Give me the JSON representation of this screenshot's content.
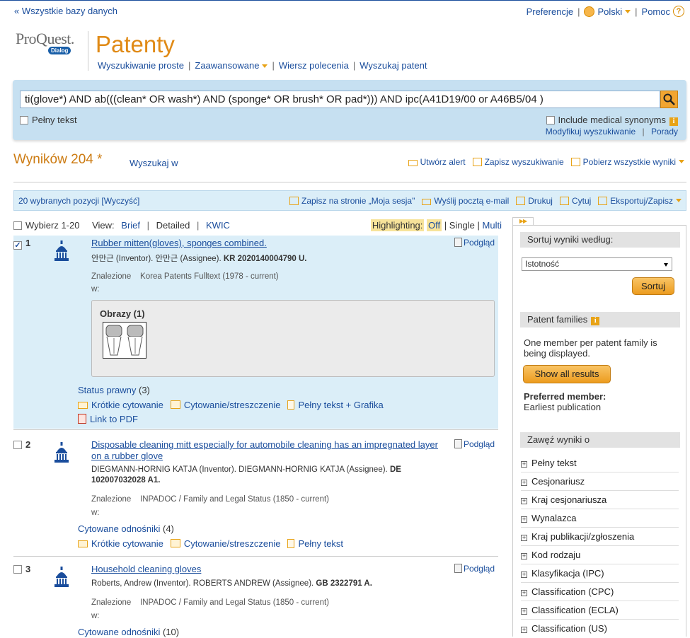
{
  "topbar": {
    "all_databases": "Wszystkie bazy danych",
    "preferences": "Preferencje",
    "language": "Polski",
    "help": "Pomoc"
  },
  "logo": {
    "brand": "ProQuest.",
    "sub": "Dialog"
  },
  "product_title": "Patenty",
  "search_nav": [
    "Wyszukiwanie proste",
    "Zaawansowane",
    "Wiersz polecenia",
    "Wyszukaj patent"
  ],
  "search": {
    "query": "ti(glove*) AND ab(((clean* OR wash*) AND (sponge* OR brush* OR pad*))) AND ipc(A41D19/00  or A46B5/04 )",
    "fulltext_label": "Pełny tekst",
    "medical_synonyms": "Include medical synonyms",
    "modify": "Modyfikuj wyszukiwanie",
    "tips": "Porady"
  },
  "results_header": {
    "count": "Wyników 204 *",
    "search_within": "Wyszukaj w",
    "create_alert": "Utwórz alert",
    "save_search": "Zapisz wyszukiwanie",
    "download_all": "Pobierz wszystkie wyniki"
  },
  "selection_bar": {
    "selected": "20 wybranych pozycji [Wyczyść]",
    "save_session": "Zapisz na stronie „Moja sesja\"",
    "email": "Wyślij pocztą e-mail",
    "print": "Drukuj",
    "cite": "Cytuj",
    "export": "Eksportuj/Zapisz"
  },
  "view": {
    "select_range": "Wybierz 1-20",
    "view_label": "View:",
    "brief": "Brief",
    "detailed": "Detailed",
    "kwic": "KWIC",
    "highlighting_label": "Highlighting:",
    "off": "Off",
    "single": "Single",
    "multi": "Multi"
  },
  "results": [
    {
      "num": "1",
      "title": "Rubber mitten(gloves), sponges combined.",
      "preview": "Podgląd",
      "meta_prefix": "안만근 (Inventor). 안만근 (Assignee). ",
      "meta_number": "KR 2020140004790 U",
      "found_label": "Znalezione",
      "found_in": "w:",
      "found_db": "Korea Patents Fulltext (1978 - current)",
      "images_title": "Obrazy (1)",
      "status_link": "Status prawny",
      "status_count": "(3)",
      "short_cite": "Krótkie cytowanie",
      "abstract": "Cytowanie/streszczenie",
      "fulltext_graphics": "Pełny tekst + Grafika",
      "pdf": "Link to PDF"
    },
    {
      "num": "2",
      "title": "Disposable cleaning mitt especially for automobile cleaning has an impregnated layer on a rubber glove",
      "preview": "Podgląd",
      "meta_prefix": "DIEGMANN-HORNIG KATJA (Inventor). DIEGMANN-HORNIG KATJA (Assignee). ",
      "meta_number": "DE 102007032028 A1",
      "found_label": "Znalezione",
      "found_in": "w:",
      "found_db": "INPADOC / Family and Legal Status (1850 - current)",
      "cited_refs": "Cytowane odnośniki",
      "cited_count": "(4)",
      "short_cite": "Krótkie cytowanie",
      "abstract": "Cytowanie/streszczenie",
      "fulltext": "Pełny tekst"
    },
    {
      "num": "3",
      "title": "Household cleaning gloves",
      "preview": "Podgląd",
      "meta_prefix": "Roberts, Andrew (Inventor). ROBERTS ANDREW (Assignee). ",
      "meta_number": "GB 2322791 A",
      "found_label": "Znalezione",
      "found_in": "w:",
      "found_db": "INPADOC / Family and Legal Status (1850 - current)",
      "cited_refs": "Cytowane odnośniki",
      "cited_count": "(10)"
    }
  ],
  "sidebar": {
    "sort_title": "Sortuj wyniki według:",
    "sort_value": "Istotność",
    "sort_button": "Sortuj",
    "pf_title": "Patent families",
    "pf_text": "One member per patent family is being displayed.",
    "show_all": "Show all results",
    "preferred_member": "Preferred member:",
    "earliest": "Earliest publication",
    "narrow_title": "Zawęź wyniki o",
    "facets": [
      "Pełny tekst",
      "Cesjonariusz",
      "Kraj cesjonariusza",
      "Wynalazca",
      "Kraj publikacji/zgłoszenia",
      "Kod rodzaju",
      "Klasyfikacja (IPC)",
      "Classification (CPC)",
      "Classification (ECLA)",
      "Classification (US)"
    ]
  },
  "colors": {
    "accent_orange": "#e08a16",
    "link_blue": "#1a4d9c",
    "panel_blue": "#c6e0f1",
    "selected_row": "#dbeef8"
  }
}
